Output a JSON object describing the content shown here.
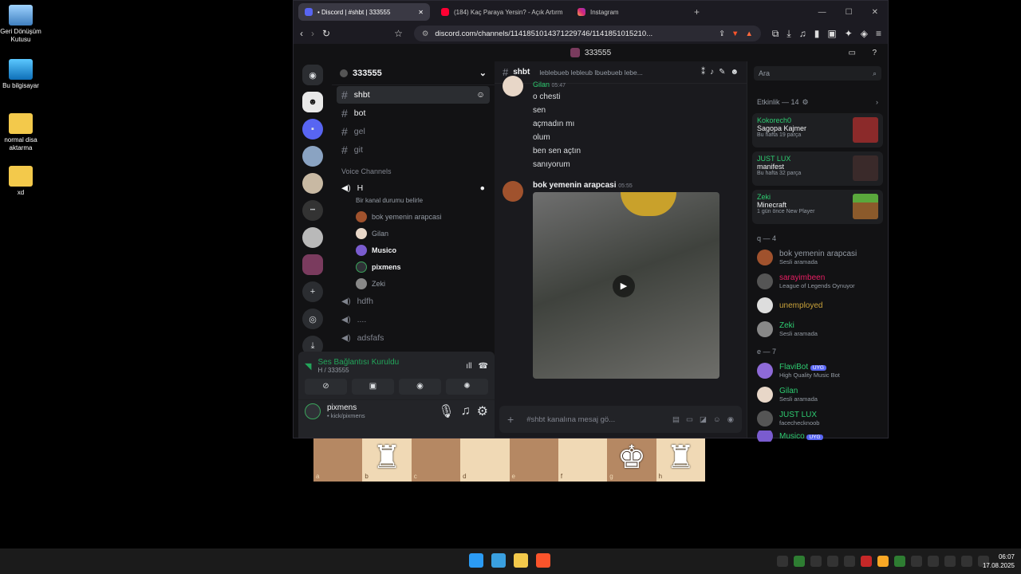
{
  "desktop": {
    "icons": [
      {
        "label": "Geri Dönüşüm Kutusu"
      },
      {
        "label": "Bu bilgisayar"
      },
      {
        "label": "normal disa aktarma"
      },
      {
        "label": "xd"
      }
    ]
  },
  "browser": {
    "tabs": [
      {
        "title": "• Discord | #shbt | 333555"
      },
      {
        "title": "(184) Kaç Paraya Yersin? - Açık Artırm"
      },
      {
        "title": "Instagram"
      }
    ],
    "url": "discord.com/channels/1141851014371229746/1141851015210..."
  },
  "discord": {
    "window_title": "333555",
    "server_name": "333555",
    "text_channels": [
      {
        "name": "shbt"
      },
      {
        "name": "bot"
      },
      {
        "name": "gel"
      },
      {
        "name": "git"
      }
    ],
    "voice_section": "Voice Channels",
    "voice_channel": {
      "name": "H",
      "status": "Bir kanal durumu belirle"
    },
    "voice_users": [
      {
        "name": "bok yemenin arapcasi"
      },
      {
        "name": "Gilan"
      },
      {
        "name": "Musico"
      },
      {
        "name": "pixmens"
      },
      {
        "name": "Zeki"
      }
    ],
    "other_voice_channels": [
      {
        "name": "hdfh"
      },
      {
        "name": "...."
      },
      {
        "name": "adsfafs"
      }
    ],
    "connection": {
      "title": "Ses Bağlantısı Kuruldu",
      "sub": "H / 333555"
    },
    "user": {
      "name": "pixmens",
      "status": "• kick/pixmens"
    },
    "channel_header": {
      "name": "shbt",
      "topic": "leblebueb lebleub lbuebueb lebe..."
    },
    "messages_top": {
      "author": "Gilan",
      "time": "05:47",
      "lines": [
        "o chesti",
        "sen",
        "açmadın mı",
        "olum",
        "ben sen açtın",
        "sanıyorum"
      ]
    },
    "message_video": {
      "author": "bok yemenin arapcasi",
      "time": "05:55"
    },
    "composer_placeholder": "#shbt kanalına mesaj gö...",
    "search_placeholder": "Ara",
    "activity_header": "Etkinlik — 14",
    "activities": [
      {
        "user": "Kokorech0",
        "title": "Sagopa Kajmer",
        "sub": "Bu hafta 19 parça"
      },
      {
        "user": "JUST LUX",
        "title": "manifest",
        "sub": "Bu hafta 32 parça"
      },
      {
        "user": "Zeki",
        "title": "Minecraft",
        "sub": "1 gün önce",
        "sub2": "New Player"
      }
    ],
    "group_q": "q — 4",
    "members_q": [
      {
        "name": "bok yemenin arapcasi",
        "status": "Sesli aramada",
        "color": "#949ba4"
      },
      {
        "name": "sarayimbeen",
        "status": "League of Legends Oynuyor",
        "color": "#e91e63"
      },
      {
        "name": "unemployed",
        "status": "",
        "color": "#c9a23a"
      },
      {
        "name": "Zeki",
        "status": "Sesli aramada",
        "color": "#2ecc71"
      }
    ],
    "group_e": "e — 7",
    "members_e": [
      {
        "name": "FlaviBot",
        "badge": "UYG",
        "status": "High Quality Music Bot",
        "color": "#2ecc71"
      },
      {
        "name": "Gilan",
        "status": "Sesli aramada",
        "color": "#2ecc71"
      },
      {
        "name": "JUST LUX",
        "status": "facechecknoob",
        "color": "#2ecc71"
      },
      {
        "name": "Musico",
        "badge": "UYG",
        "status": "",
        "color": "#2ecc71"
      }
    ]
  },
  "chess_files": [
    "a",
    "b",
    "c",
    "d",
    "e",
    "f",
    "g",
    "h"
  ],
  "taskbar": {
    "time": "06:07",
    "date": "17.08.2025"
  }
}
